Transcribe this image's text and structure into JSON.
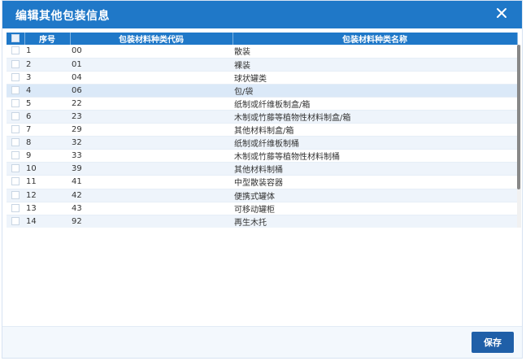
{
  "dialog": {
    "title": "编辑其他包装信息",
    "save_label": "保存"
  },
  "table": {
    "headers": [
      "序号",
      "包装材料种类代码",
      "包装材料种类名称"
    ],
    "rows": [
      {
        "no": "1",
        "code": "00",
        "name": "散装"
      },
      {
        "no": "2",
        "code": "01",
        "name": "裸装"
      },
      {
        "no": "3",
        "code": "04",
        "name": "球状罐类"
      },
      {
        "no": "4",
        "code": "06",
        "name": "包/袋"
      },
      {
        "no": "5",
        "code": "22",
        "name": "纸制或纤维板制盒/箱"
      },
      {
        "no": "6",
        "code": "23",
        "name": "木制或竹藤等植物性材料制盒/箱"
      },
      {
        "no": "7",
        "code": "29",
        "name": "其他材料制盒/箱"
      },
      {
        "no": "8",
        "code": "32",
        "name": "纸制或纤维板制桶"
      },
      {
        "no": "9",
        "code": "33",
        "name": "木制或竹藤等植物性材料制桶"
      },
      {
        "no": "10",
        "code": "39",
        "name": "其他材料制桶"
      },
      {
        "no": "11",
        "code": "41",
        "name": "中型散装容器"
      },
      {
        "no": "12",
        "code": "42",
        "name": "便携式罐体"
      },
      {
        "no": "13",
        "code": "43",
        "name": "可移动罐柜"
      },
      {
        "no": "14",
        "code": "92",
        "name": "再生木托"
      }
    ]
  }
}
